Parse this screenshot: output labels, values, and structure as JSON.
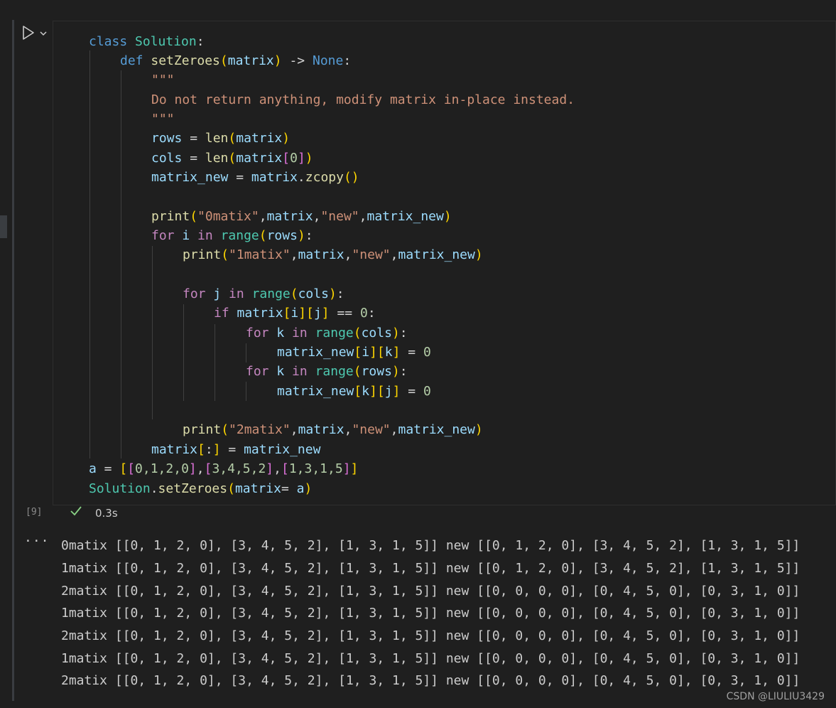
{
  "cell": {
    "execution_count": "[9]",
    "status": "0.3s",
    "run_icon": "play-icon",
    "chevron_icon": "chevron-down-icon",
    "status_icon": "check-icon"
  },
  "code": {
    "l1": {
      "kw": "class",
      "name": "Solution",
      "p": ":"
    },
    "l2": {
      "kw": "def",
      "name": "setZeroes",
      "o": "(",
      "arg": "matrix",
      "c": ")",
      "arrow": " -> ",
      "none": "None",
      "p": ":"
    },
    "l3": "\"\"\"",
    "l4": "Do not return anything, modify matrix in-place instead.",
    "l5": "\"\"\"",
    "l6": {
      "v": "rows",
      "eq": " = ",
      "f": "len",
      "o": "(",
      "a": "matrix",
      "c": ")"
    },
    "l7": {
      "v": "cols",
      "eq": " = ",
      "f": "len",
      "o": "(",
      "a": "matrix",
      "io": "[",
      "n": "0",
      "ic": "]",
      "c": ")"
    },
    "l8": {
      "v": "matrix_new",
      "eq": " = ",
      "a": "matrix",
      "dot": ".",
      "f": "zcopy",
      "o": "(",
      "c": ")"
    },
    "l10": {
      "f": "print",
      "o": "(",
      "s1": "\"0matix\"",
      "cm1": ",",
      "a1": "matrix",
      "cm2": ",",
      "s2": "\"new\"",
      "cm3": ",",
      "a2": "matrix_new",
      "c": ")"
    },
    "l11": {
      "kw": "for",
      "v": " i ",
      "in": "in",
      "sp": " ",
      "f": "range",
      "o": "(",
      "a": "rows",
      "c": ")",
      "p": ":"
    },
    "l12": {
      "f": "print",
      "o": "(",
      "s1": "\"1matix\"",
      "cm1": ",",
      "a1": "matrix",
      "cm2": ",",
      "s2": "\"new\"",
      "cm3": ",",
      "a2": "matrix_new",
      "c": ")"
    },
    "l14": {
      "kw": "for",
      "v": " j ",
      "in": "in",
      "sp": " ",
      "f": "range",
      "o": "(",
      "a": "cols",
      "c": ")",
      "p": ":"
    },
    "l15": {
      "kw": "if",
      "sp": " ",
      "a": "matrix",
      "i1o": "[",
      "i1": "i",
      "i1c": "]",
      "i2o": "[",
      "i2": "j",
      "i2c": "]",
      "eq": " == ",
      "n": "0",
      "p": ":"
    },
    "l16": {
      "kw": "for",
      "v": " k ",
      "in": "in",
      "sp": " ",
      "f": "range",
      "o": "(",
      "a": "cols",
      "c": ")",
      "p": ":"
    },
    "l17": {
      "a": "matrix_new",
      "i1o": "[",
      "i1": "i",
      "i1c": "]",
      "i2o": "[",
      "i2": "k",
      "i2c": "]",
      "eq": " = ",
      "n": "0"
    },
    "l18": {
      "kw": "for",
      "v": " k ",
      "in": "in",
      "sp": " ",
      "f": "range",
      "o": "(",
      "a": "rows",
      "c": ")",
      "p": ":"
    },
    "l19": {
      "a": "matrix_new",
      "i1o": "[",
      "i1": "k",
      "i1c": "]",
      "i2o": "[",
      "i2": "j",
      "i2c": "]",
      "eq": " = ",
      "n": "0"
    },
    "l21": {
      "f": "print",
      "o": "(",
      "s1": "\"2matix\"",
      "cm1": ",",
      "a1": "matrix",
      "cm2": ",",
      "s2": "\"new\"",
      "cm3": ",",
      "a2": "matrix_new",
      "c": ")"
    },
    "l22": {
      "a": "matrix",
      "o": "[",
      "s": ":",
      "c": "]",
      "eq": " = ",
      "b": "matrix_new"
    },
    "l23": {
      "a": "a",
      "eq": " = ",
      "o1": "[",
      "o2": "[",
      "r1": "0,1,2,0",
      "c2": "]",
      "cm1": ",",
      "o3": "[",
      "r2": "3,4,5,2",
      "c3": "]",
      "cm2": ",",
      "o4": "[",
      "r3": "1,3,1,5",
      "c4": "]",
      "c1": "]"
    },
    "l24": {
      "cls": "Solution",
      "dot": ".",
      "f": "setZeroes",
      "o": "(",
      "arg": "matrix",
      "eq": "= ",
      "a": "a",
      "c": ")"
    }
  },
  "output": {
    "more_icon": "ellipsis-icon",
    "lines": [
      "0matix [[0, 1, 2, 0], [3, 4, 5, 2], [1, 3, 1, 5]] new [[0, 1, 2, 0], [3, 4, 5, 2], [1, 3, 1, 5]]",
      "1matix [[0, 1, 2, 0], [3, 4, 5, 2], [1, 3, 1, 5]] new [[0, 1, 2, 0], [3, 4, 5, 2], [1, 3, 1, 5]]",
      "2matix [[0, 1, 2, 0], [3, 4, 5, 2], [1, 3, 1, 5]] new [[0, 0, 0, 0], [0, 4, 5, 0], [0, 3, 1, 0]]",
      "1matix [[0, 1, 2, 0], [3, 4, 5, 2], [1, 3, 1, 5]] new [[0, 0, 0, 0], [0, 4, 5, 0], [0, 3, 1, 0]]",
      "2matix [[0, 1, 2, 0], [3, 4, 5, 2], [1, 3, 1, 5]] new [[0, 0, 0, 0], [0, 4, 5, 0], [0, 3, 1, 0]]",
      "1matix [[0, 1, 2, 0], [3, 4, 5, 2], [1, 3, 1, 5]] new [[0, 0, 0, 0], [0, 4, 5, 0], [0, 3, 1, 0]]",
      "2matix [[0, 1, 2, 0], [3, 4, 5, 2], [1, 3, 1, 5]] new [[0, 0, 0, 0], [0, 4, 5, 0], [0, 3, 1, 0]]"
    ]
  },
  "watermark": "CSDN @LIULIU3429"
}
